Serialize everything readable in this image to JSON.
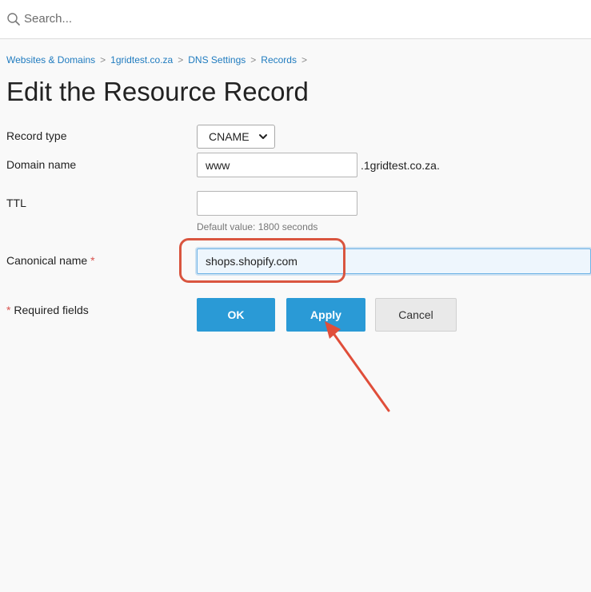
{
  "search": {
    "placeholder": "Search..."
  },
  "breadcrumb": {
    "items": [
      "Websites & Domains",
      "1gridtest.co.za",
      "DNS Settings",
      "Records"
    ],
    "separator": ">"
  },
  "page": {
    "title": "Edit the Resource Record"
  },
  "form": {
    "record_type": {
      "label": "Record type",
      "value": "CNAME"
    },
    "domain_name": {
      "label": "Domain name",
      "value": "www",
      "suffix": ".1gridtest.co.za."
    },
    "ttl": {
      "label": "TTL",
      "value": "",
      "hint": "Default value: 1800 seconds"
    },
    "canonical_name": {
      "label": "Canonical name",
      "required_marker": "*",
      "value": "shops.shopify.com"
    },
    "required_note": {
      "marker": "*",
      "text": "Required fields"
    }
  },
  "buttons": {
    "ok": "OK",
    "apply": "Apply",
    "cancel": "Cancel"
  },
  "colors": {
    "primary_button": "#2a9ad6",
    "link": "#1f7bbf",
    "required": "#d9534f",
    "annotation": "#d9553f"
  },
  "icons": {
    "search": "search-icon",
    "dropdown": "chevron-down-icon",
    "annotation_arrow": "arrow-annotation"
  }
}
